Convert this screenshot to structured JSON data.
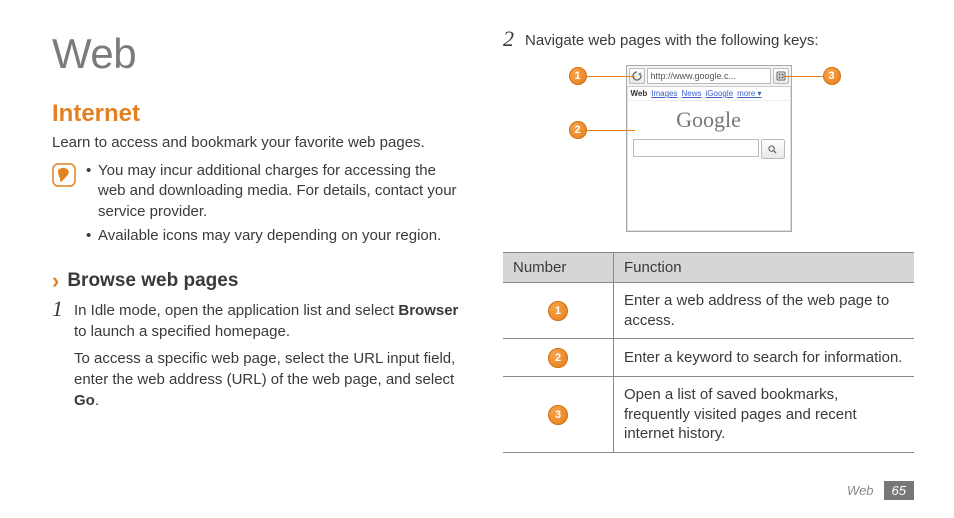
{
  "page_title": "Web",
  "section_title": "Internet",
  "intro": "Learn to access and bookmark your favorite web pages.",
  "notes": [
    "You may incur additional charges for accessing the web and downloading media. For details, contact your service provider.",
    "Available icons may vary depending on your region."
  ],
  "sub_heading": "Browse web pages",
  "step1_num": "1",
  "step1_a_pre": "In Idle mode, open the application list and select ",
  "step1_a_bold": "Browser",
  "step1_a_post": " to launch a specified homepage.",
  "step1_b_pre": "To access a specific web page, select the URL input field, enter the web address (URL) of the web page, and select ",
  "step1_b_bold": "Go",
  "step1_b_post": ".",
  "step2_num": "2",
  "step2_text": "Navigate web pages with the following keys:",
  "mock_url": "http://www.google.c...",
  "mock_tabs": [
    "Web",
    "Images",
    "News",
    "iGoogle",
    "more ▾"
  ],
  "mock_logo": "Google",
  "callouts": {
    "c1": "1",
    "c2": "2",
    "c3": "3"
  },
  "table_headers": [
    "Number",
    "Function"
  ],
  "table_rows": [
    "Enter a web address of the web page to access.",
    "Enter a keyword to search for information.",
    "Open a list of saved bookmarks, frequently visited pages and recent internet history."
  ],
  "footer_section": "Web",
  "footer_page": "65"
}
